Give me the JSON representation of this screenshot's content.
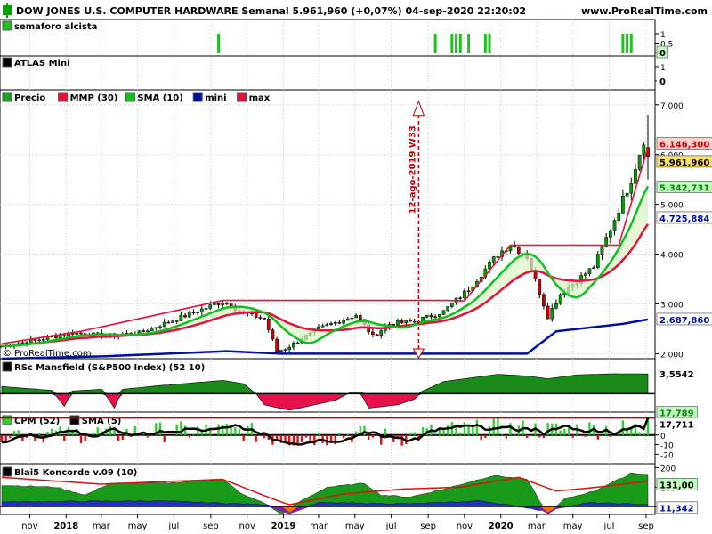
{
  "header": {
    "title": "DOW JONES U.S. COMPUTER HARDWARE Semanal 5.961,960 (+0,07%) 04-sep-2020 22:20:02",
    "site": "www.ProRealTime.com"
  },
  "colors": {
    "price_up": "#00a000",
    "price_down": "#cc0000",
    "mmp": "#e8103a",
    "sma": "#10c020",
    "mini": "#0010a0",
    "max": "#e8103a",
    "mansfield_pos": "#1a8a1a",
    "mansfield_neg": "#e8104a",
    "cpm_pos": "#30d030",
    "cpm_neg": "#e01010",
    "cpm_line": "#000000",
    "cpm_ref": "#c00000",
    "konc_green": "#1a9a1a",
    "konc_blue": "#2030c0",
    "konc_purple": "#8020a0",
    "konc_orange": "#f07010",
    "konc_red": "#e01010",
    "alert_green": "#20c020",
    "label_pos_bg": "#c0ffc0",
    "label_neg_bg": "#ffd0d0",
    "last_bg": "#ffe060"
  },
  "time_axis": {
    "labels": [
      "nov",
      "2018",
      "mar",
      "may",
      "jul",
      "sep",
      "nov",
      "2019",
      "mar",
      "may",
      "jul",
      "sep",
      "nov",
      "2020",
      "mar",
      "may",
      "jul",
      "sep"
    ],
    "label_dates": [
      "2017-11-01",
      "2018-01-01",
      "2018-03-01",
      "2018-05-01",
      "2018-07-01",
      "2018-09-01",
      "2018-11-01",
      "2019-01-01",
      "2019-03-01",
      "2019-05-01",
      "2019-07-01",
      "2019-09-01",
      "2019-11-01",
      "2020-01-01",
      "2020-03-01",
      "2020-05-01",
      "2020-07-01",
      "2020-09-01"
    ],
    "start": "2017-09-15",
    "end": "2020-09-04"
  },
  "panels": {
    "semaforo": {
      "legend": "semaforo alcista",
      "ticks": [
        "1",
        "0,5",
        "0"
      ],
      "last_label": "0",
      "signal_dates": [
        "2018-09-14",
        "2019-09-13",
        "2019-10-11",
        "2019-10-18",
        "2019-10-25",
        "2019-11-08",
        "2019-12-06",
        "2019-12-13",
        "2020-07-24",
        "2020-07-31",
        "2020-08-07"
      ]
    },
    "atlas": {
      "legend": "ATLAS Mini",
      "ticks": [
        "1",
        "0"
      ],
      "last_label": "0"
    },
    "price": {
      "legends": [
        "Precio",
        "MMP (30)",
        "SMA (10)",
        "mini",
        "max"
      ],
      "ticks": [
        "7.000",
        "6.000",
        "5.000",
        "4.000",
        "3.000",
        "2.000"
      ],
      "labels": [
        "6.146,300",
        "5.961,960",
        "5.342,731",
        "4.725,884",
        "2.687,860"
      ],
      "annotation": "12-ago-2019 W33",
      "watermark": "© ProRealTime.com"
    },
    "mansfield": {
      "legend": "RSc Mansfield (S&P500 Index) (52 10)",
      "last_label": "3,5542"
    },
    "cpm": {
      "legends": [
        "CPM (52)",
        "SMA (5)"
      ],
      "ticks": [
        "20",
        "10",
        "0",
        "-10",
        "-20"
      ],
      "labels": [
        "17,789",
        "17,711"
      ]
    },
    "koncorde": {
      "legend": "Blai5 Koncorde v.09 (10)",
      "ticks": [
        "200",
        "100",
        "0"
      ],
      "labels": [
        "131,00",
        "11,342"
      ]
    }
  },
  "chart_data": [
    {
      "type": "candlestick",
      "title": "DOW JONES U.S. COMPUTER HARDWARE Semanal",
      "ylim": [
        1900,
        7300
      ],
      "close_anchors": [
        [
          "2017-09-15",
          2150
        ],
        [
          "2017-11-15",
          2280
        ],
        [
          "2018-01-12",
          2420
        ],
        [
          "2018-03-09",
          2360
        ],
        [
          "2018-05-04",
          2420
        ],
        [
          "2018-07-06",
          2700
        ],
        [
          "2018-09-21",
          3050
        ],
        [
          "2018-10-26",
          2820
        ],
        [
          "2018-11-30",
          2700
        ],
        [
          "2018-12-21",
          2050
        ],
        [
          "2019-01-04",
          2100
        ],
        [
          "2019-03-01",
          2500
        ],
        [
          "2019-05-03",
          2780
        ],
        [
          "2019-05-31",
          2350
        ],
        [
          "2019-06-28",
          2600
        ],
        [
          "2019-08-09",
          2650
        ],
        [
          "2019-09-27",
          2850
        ],
        [
          "2019-11-08",
          3300
        ],
        [
          "2019-12-27",
          4000
        ],
        [
          "2020-01-17",
          4200
        ],
        [
          "2020-02-14",
          3950
        ],
        [
          "2020-03-20",
          2750
        ],
        [
          "2020-04-10",
          3200
        ],
        [
          "2020-05-01",
          3400
        ],
        [
          "2020-06-05",
          3750
        ],
        [
          "2020-07-10",
          4700
        ],
        [
          "2020-08-07",
          5500
        ],
        [
          "2020-08-28",
          6300
        ],
        [
          "2020-09-04",
          5962
        ]
      ],
      "last": {
        "open": 6146.3,
        "high": 6800,
        "low": 5500,
        "close": 5961.96
      }
    },
    {
      "type": "line",
      "series": [
        {
          "name": "MMP (30)",
          "values_ref": "price_close_weighted_30"
        },
        {
          "name": "SMA (10)",
          "values_ref": "price_close_10"
        },
        {
          "name": "mini",
          "values": [
            [
              "2017-09-15",
              1900
            ],
            [
              "2018-03-09",
              1950
            ],
            [
              "2018-09-28",
              2050
            ],
            [
              "2018-12-28",
              2000
            ],
            [
              "2019-01-04",
              2000
            ],
            [
              "2020-02-14",
              2000
            ],
            [
              "2020-04-03",
              2450
            ],
            [
              "2020-07-24",
              2600
            ],
            [
              "2020-09-04",
              2687.86
            ]
          ]
        },
        {
          "name": "max",
          "values": [
            [
              "2017-09-15",
              2200
            ],
            [
              "2018-01-26",
              2450
            ],
            [
              "2018-09-21",
              3070
            ],
            [
              "2019-10-04",
              3070
            ],
            [
              "2019-11-01",
              3060
            ],
            [
              "2020-01-17",
              4180
            ],
            [
              "2020-07-17",
              4180
            ],
            [
              "2020-09-04",
              6146.3
            ]
          ]
        }
      ]
    },
    {
      "type": "area",
      "title": "RSc Mansfield (S&P500 Index) (52 10)",
      "ylim": [
        -3,
        6
      ],
      "values": [
        [
          "2017-09-15",
          1.3
        ],
        [
          "2017-12-08",
          0.6
        ],
        [
          "2017-12-29",
          -2.3
        ],
        [
          "2018-01-12",
          0.5
        ],
        [
          "2018-03-02",
          0.8
        ],
        [
          "2018-03-23",
          -2.6
        ],
        [
          "2018-04-06",
          0.8
        ],
        [
          "2018-06-01",
          1.4
        ],
        [
          "2018-09-21",
          2.4
        ],
        [
          "2018-10-26",
          1.8
        ],
        [
          "2018-11-16",
          0
        ],
        [
          "2018-11-30",
          -2
        ],
        [
          "2019-01-11",
          -3
        ],
        [
          "2019-02-22",
          -2
        ],
        [
          "2019-03-29",
          -1.2
        ],
        [
          "2019-04-12",
          -0.4
        ],
        [
          "2019-04-26",
          0.3
        ],
        [
          "2019-05-10",
          0.3
        ],
        [
          "2019-05-24",
          -2.6
        ],
        [
          "2019-07-12",
          -2
        ],
        [
          "2019-08-09",
          -1
        ],
        [
          "2019-08-23",
          0.5
        ],
        [
          "2019-09-27",
          2.2
        ],
        [
          "2019-10-25",
          2.6
        ],
        [
          "2019-12-27",
          3.5
        ],
        [
          "2020-02-14",
          3.2
        ],
        [
          "2020-03-20",
          2.7
        ],
        [
          "2020-05-08",
          3.4
        ],
        [
          "2020-07-10",
          3.6
        ],
        [
          "2020-09-04",
          3.5542
        ]
      ]
    },
    {
      "type": "bar",
      "title": "CPM (52) / SMA (5)",
      "ylim": [
        -28,
        22
      ],
      "values_note": "weekly oscillator, last 17,789",
      "last": 17.789,
      "sma_last": 17.711
    },
    {
      "type": "area",
      "title": "Blai5 Koncorde v.09 (10)",
      "ylim": [
        -40,
        220
      ],
      "green": [
        [
          "2017-09-15",
          110
        ],
        [
          "2017-12-15",
          100
        ],
        [
          "2018-02-02",
          60
        ],
        [
          "2018-03-16",
          120
        ],
        [
          "2018-06-15",
          120
        ],
        [
          "2018-09-21",
          140
        ],
        [
          "2018-10-26",
          60
        ],
        [
          "2018-11-30",
          20
        ],
        [
          "2018-12-28",
          -40
        ],
        [
          "2019-01-25",
          20
        ],
        [
          "2019-03-15",
          100
        ],
        [
          "2019-05-17",
          120
        ],
        [
          "2019-06-14",
          60
        ],
        [
          "2019-08-02",
          50
        ],
        [
          "2019-09-27",
          90
        ],
        [
          "2019-12-20",
          160
        ],
        [
          "2020-02-14",
          140
        ],
        [
          "2020-03-20",
          -40
        ],
        [
          "2020-04-17",
          40
        ],
        [
          "2020-06-05",
          80
        ],
        [
          "2020-08-07",
          170
        ],
        [
          "2020-09-04",
          160
        ]
      ],
      "blue": [
        [
          "2017-09-15",
          25
        ],
        [
          "2018-06-01",
          30
        ],
        [
          "2018-12-07",
          10
        ],
        [
          "2019-01-11",
          -30
        ],
        [
          "2019-03-01",
          20
        ],
        [
          "2019-08-09",
          15
        ],
        [
          "2019-11-29",
          30
        ],
        [
          "2020-03-13",
          -20
        ],
        [
          "2020-05-29",
          20
        ],
        [
          "2020-09-04",
          11.342
        ]
      ],
      "signal": [
        [
          "2017-09-15",
          150
        ],
        [
          "2018-03-02",
          115
        ],
        [
          "2018-09-21",
          140
        ],
        [
          "2018-12-14",
          40
        ],
        [
          "2019-01-11",
          10
        ],
        [
          "2019-04-12",
          65
        ],
        [
          "2019-07-19",
          90
        ],
        [
          "2019-10-25",
          100
        ],
        [
          "2020-01-31",
          150
        ],
        [
          "2020-04-03",
          80
        ],
        [
          "2020-06-12",
          100
        ],
        [
          "2020-09-04",
          131
        ]
      ]
    }
  ]
}
